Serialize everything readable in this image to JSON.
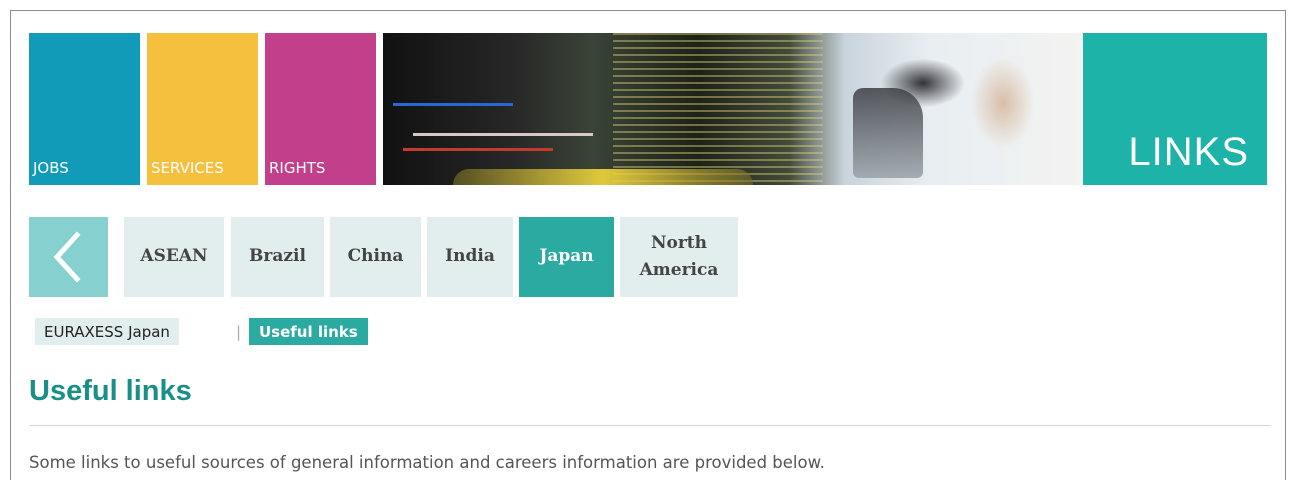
{
  "banner": {
    "tiles": [
      {
        "label": "JOBS",
        "color": "#129bb9"
      },
      {
        "label": "SERVICES",
        "color": "#f5c03e"
      },
      {
        "label": "RIGHTS",
        "color": "#c23f8b"
      }
    ],
    "section_label": "LINKS",
    "section_color": "#1eb3a8"
  },
  "country_nav": {
    "back_icon": "chevron-left-icon",
    "tabs": [
      {
        "label": "ASEAN"
      },
      {
        "label": "Brazil"
      },
      {
        "label": "China"
      },
      {
        "label": "India"
      },
      {
        "label": "Japan",
        "active": true
      },
      {
        "label": "North America"
      }
    ],
    "active_color": "#2aaaa1",
    "inactive_color": "#e2eeee"
  },
  "breadcrumb": {
    "items": [
      {
        "label": "EURAXESS Japan"
      },
      {
        "label": "Useful links",
        "current": true
      }
    ],
    "separator": "|"
  },
  "content": {
    "title": "Useful links",
    "intro": "Some links to useful sources of general information and careers information are provided below."
  }
}
